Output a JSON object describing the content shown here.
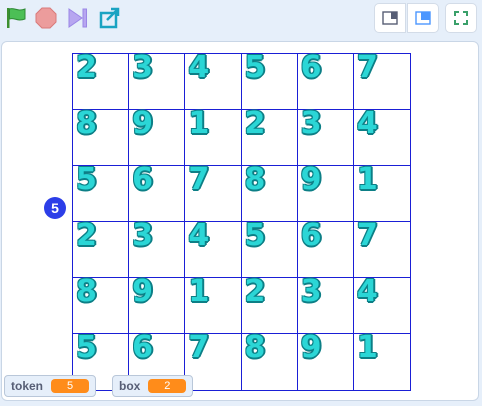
{
  "toolbar": {
    "green_flag": "green-flag-icon",
    "stop": "stop-icon",
    "turbo": "turbo-icon",
    "share": "share-icon"
  },
  "stage": {
    "grid_digits": [
      [
        "2",
        "3",
        "4",
        "5",
        "6",
        "7"
      ],
      [
        "8",
        "9",
        "1",
        "2",
        "3",
        "4"
      ],
      [
        "5",
        "6",
        "7",
        "8",
        "9",
        "1"
      ],
      [
        "2",
        "3",
        "4",
        "5",
        "6",
        "7"
      ],
      [
        "8",
        "9",
        "1",
        "2",
        "3",
        "4"
      ],
      [
        "5",
        "6",
        "7",
        "8",
        "9",
        "1"
      ]
    ],
    "badge_value": "5",
    "monitors": [
      {
        "label": "token",
        "value": "5"
      },
      {
        "label": "box",
        "value": "2"
      }
    ]
  },
  "colors": {
    "digit_fill": "#2bd6d6",
    "digit_outline": "#0d7f86",
    "grid_line": "#1a1fd6",
    "monitor_value": "#ff8c1a",
    "badge": "#2c3ee8"
  }
}
